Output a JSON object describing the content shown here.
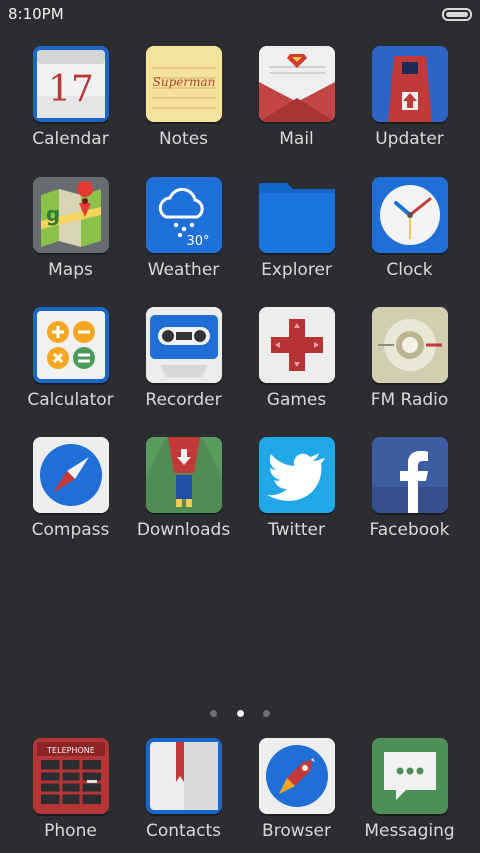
{
  "status_bar": {
    "time": "8:10PM"
  },
  "apps_row1": [
    {
      "label": "Calendar",
      "calendar_day": "17"
    },
    {
      "label": "Notes",
      "note_text": "Superman"
    },
    {
      "label": "Mail"
    },
    {
      "label": "Updater"
    }
  ],
  "apps_row2": [
    {
      "label": "Maps"
    },
    {
      "label": "Weather",
      "temperature": "30°"
    },
    {
      "label": "Explorer"
    },
    {
      "label": "Clock"
    }
  ],
  "apps_row3": [
    {
      "label": "Calculator"
    },
    {
      "label": "Recorder"
    },
    {
      "label": "Games"
    },
    {
      "label": "FM Radio"
    }
  ],
  "apps_row4": [
    {
      "label": "Compass"
    },
    {
      "label": "Downloads"
    },
    {
      "label": "Twitter"
    },
    {
      "label": "Facebook"
    }
  ],
  "dock": [
    {
      "label": "Phone",
      "booth_text": "TELEPHONE"
    },
    {
      "label": "Contacts"
    },
    {
      "label": "Browser"
    },
    {
      "label": "Messaging"
    }
  ],
  "page_indicator": {
    "pages": 3,
    "active_page": 2
  }
}
